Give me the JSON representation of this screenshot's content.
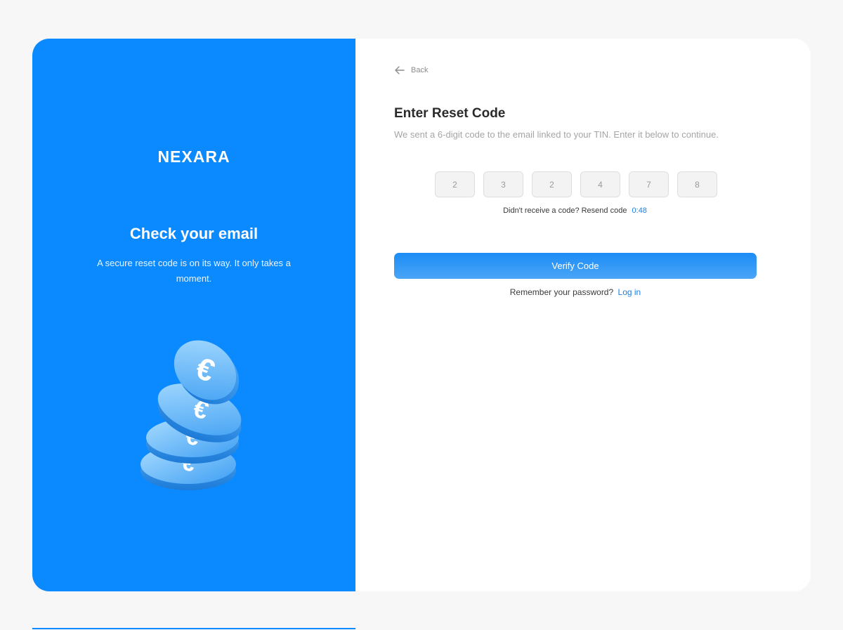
{
  "left_panel": {
    "brand": "NEXARA",
    "title": "Check your email",
    "subtitle": "A secure reset code is on its way. It only takes a moment.",
    "illustration": "euro-coins-stack",
    "accent_color": "#0b8aff"
  },
  "right_panel": {
    "back_label": "Back",
    "title": "Enter Reset Code",
    "subtitle": "We sent a 6-digit code to the email linked to your TIN. Enter it below to continue.",
    "code_digits": [
      "2",
      "3",
      "2",
      "4",
      "7",
      "8"
    ],
    "resend_text": "Didn't receive a code? Resend code",
    "timer": "0:48",
    "verify_label": "Verify Code",
    "remember_text": "Remember your password?",
    "login_label": "Log in",
    "link_color": "#1e7fe0"
  }
}
